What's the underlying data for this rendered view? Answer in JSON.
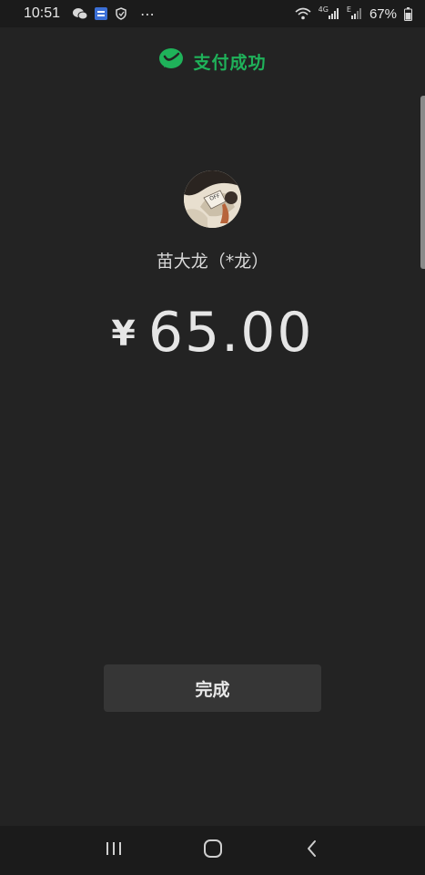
{
  "status_bar": {
    "time": "10:51",
    "battery_percent": "67%",
    "network_labels": [
      "4G",
      "E"
    ],
    "more_icon": "⋯"
  },
  "header": {
    "success_text": "支付成功",
    "accent_color": "#1fb25a"
  },
  "payee": {
    "name": "苗大龙（*龙）"
  },
  "payment": {
    "currency_symbol": "¥",
    "amount": "65.00"
  },
  "actions": {
    "done_label": "完成"
  },
  "icons": {
    "status_left": [
      "wechat-icon",
      "app-notification-icon",
      "shield-icon",
      "more-icon"
    ],
    "status_right": [
      "wifi-icon",
      "signal-icon",
      "signal-icon",
      "battery-icon"
    ],
    "nav": [
      "recent-apps-icon",
      "home-icon",
      "back-icon"
    ]
  }
}
